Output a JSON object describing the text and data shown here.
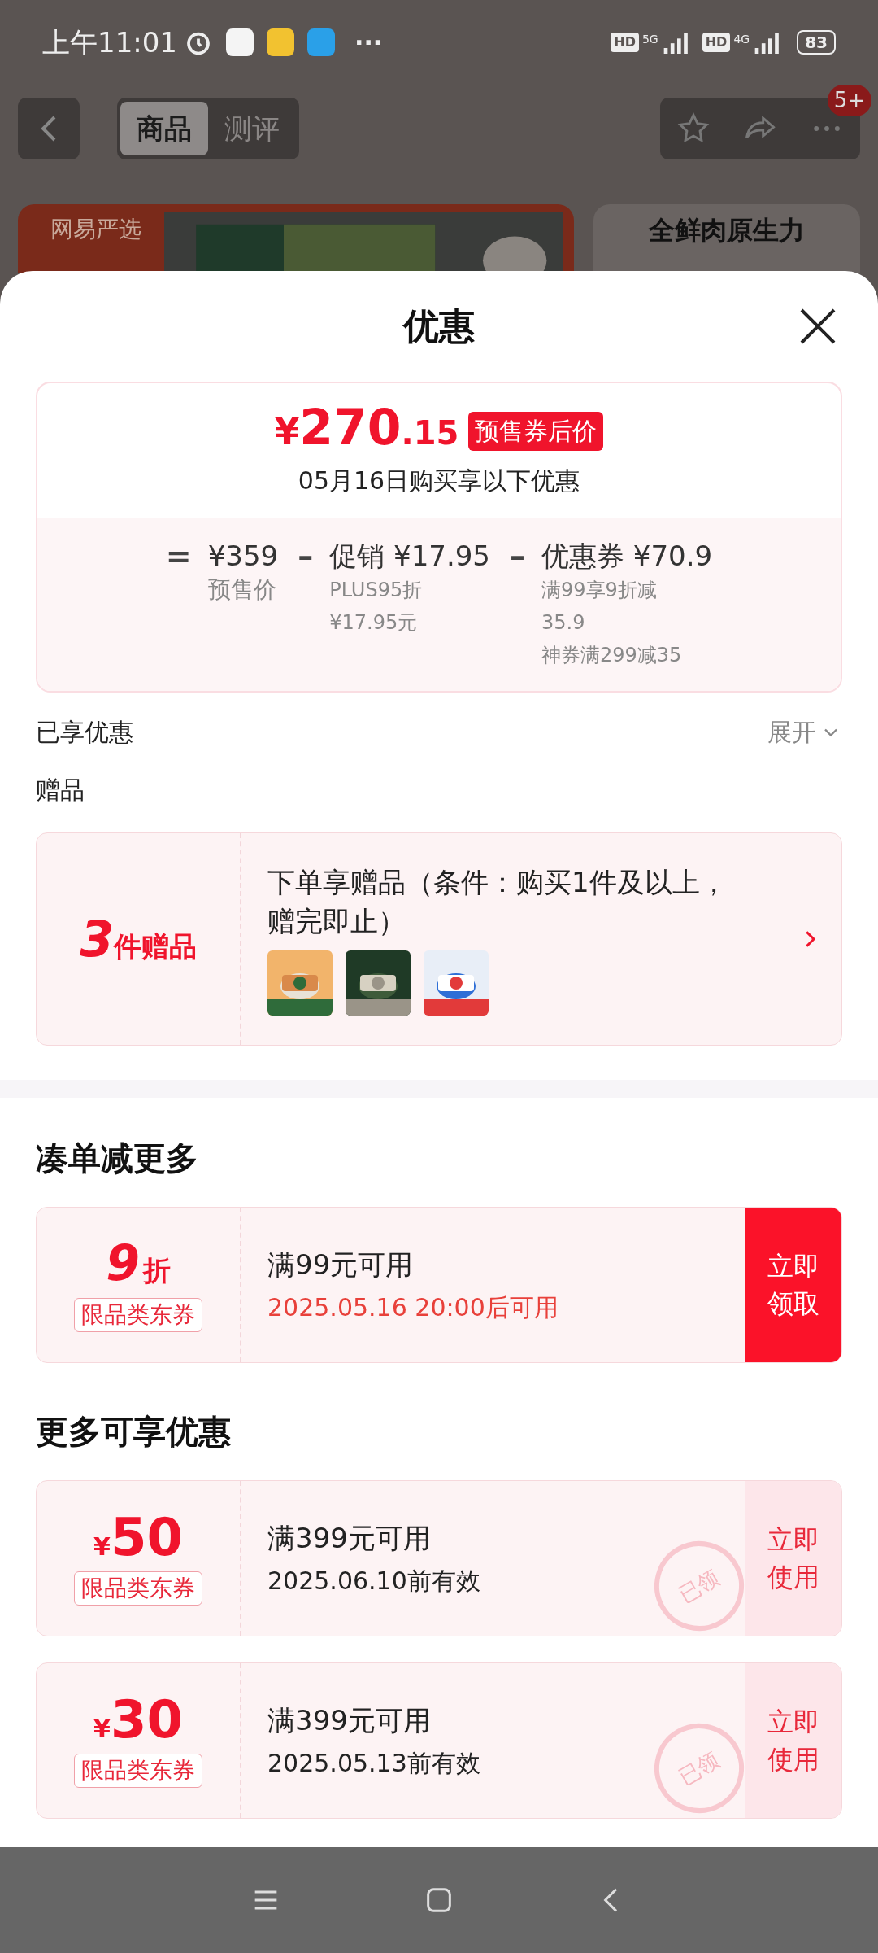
{
  "status_bar": {
    "time": "上午11:01",
    "more": "···",
    "sim1": {
      "hd": "HD",
      "net": "5G"
    },
    "sim2": {
      "hd": "HD",
      "net": "4G"
    },
    "battery": "83"
  },
  "background": {
    "tabs": [
      {
        "label": "商品",
        "selected": true
      },
      {
        "label": "测评",
        "selected": false
      }
    ],
    "badge": "5+",
    "brand": "网易严选",
    "banner": "全鲜肉原生力"
  },
  "sheet": {
    "title": "优惠",
    "price": {
      "symbol": "¥",
      "integer": "270",
      "decimal": ".15",
      "tag": "预售券后价",
      "note": "05月16日购买享以下优惠",
      "breakdown": [
        {
          "kind": "base",
          "operator": "=",
          "amount": "¥359",
          "lines": [
            "预售价"
          ]
        },
        {
          "kind": "deduction",
          "operator": "–",
          "label": "促销",
          "amount": "¥17.95",
          "lines": [
            "PLUS95折",
            "¥17.95元"
          ]
        },
        {
          "kind": "deduction",
          "operator": "–",
          "label": "优惠券",
          "amount": "¥70.9",
          "lines": [
            "满99享9折减35.9",
            "神券满299减35"
          ]
        }
      ]
    },
    "enjoyed": {
      "label": "已享优惠",
      "toggle": "展开"
    },
    "gifts": {
      "heading": "赠品",
      "count": "3",
      "unit": "件赠品",
      "text": "下单享赠品（条件：购买1件及以上，赠完即止）"
    },
    "sections": [
      {
        "heading": "凑单减更多",
        "coupons": [
          {
            "kind": "discount",
            "value": "9",
            "unit": "折",
            "tag": "限品类东券",
            "condition": "满99元可用",
            "validity": "2025.05.16 20:00后可用",
            "action": "立即领取",
            "claimed": false
          }
        ]
      },
      {
        "heading": "更多可享优惠",
        "coupons": [
          {
            "kind": "amount",
            "symbol": "¥",
            "value": "50",
            "tag": "限品类东券",
            "condition": "满399元可用",
            "validity": "2025.06.10前有效",
            "action": "立即使用",
            "claimed": true,
            "stamp": "已领"
          },
          {
            "kind": "amount",
            "symbol": "¥",
            "value": "30",
            "tag": "限品类东券",
            "condition": "满399元可用",
            "validity": "2025.05.13前有效",
            "action": "立即使用",
            "claimed": true,
            "stamp": "已领"
          }
        ]
      }
    ]
  }
}
